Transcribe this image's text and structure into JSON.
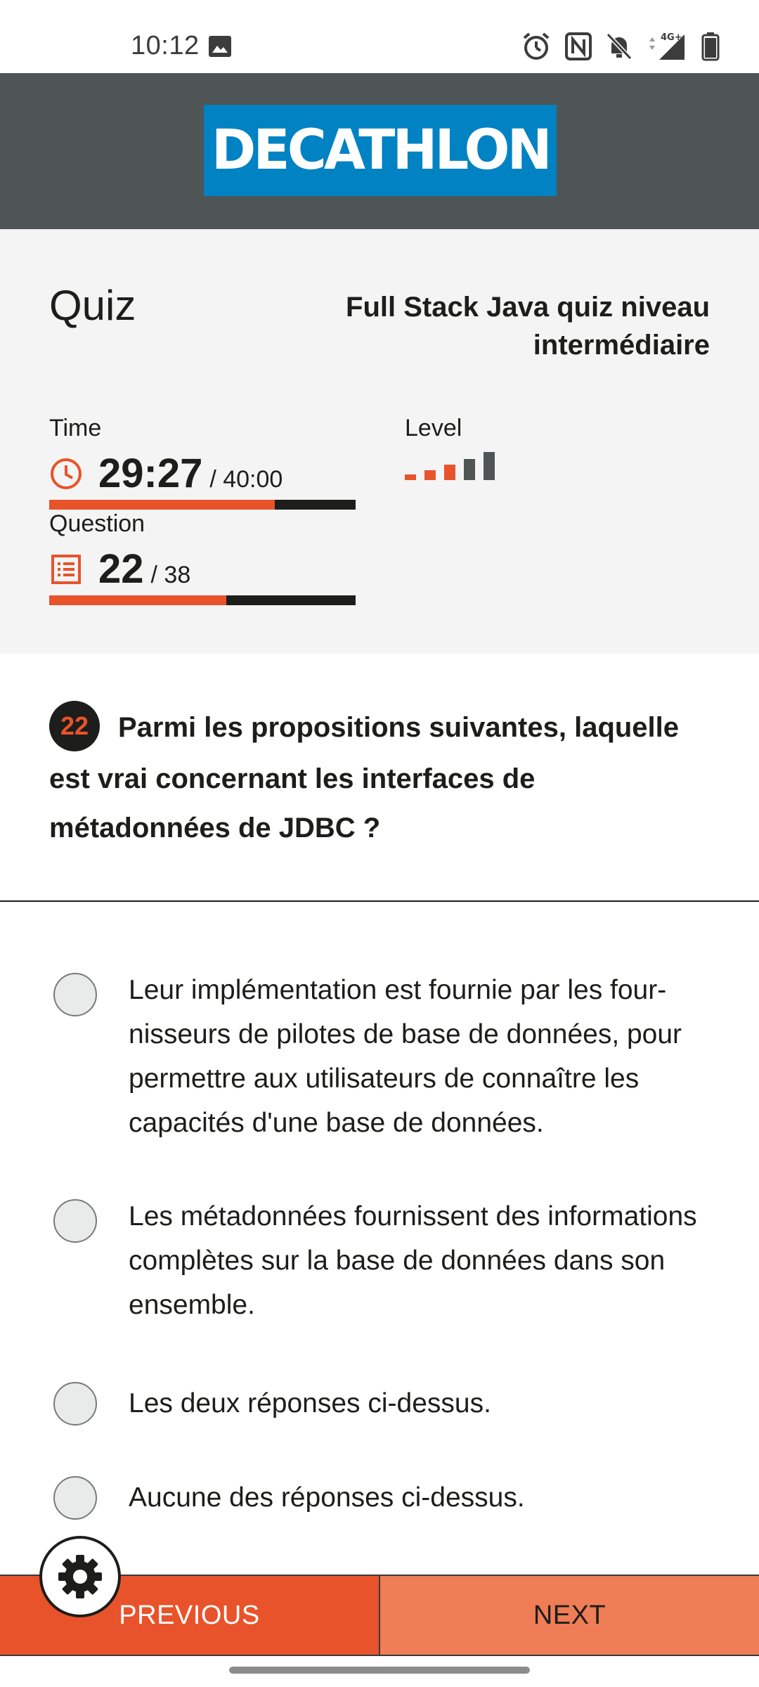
{
  "status_bar": {
    "time": "10:12",
    "icons": [
      "image-icon",
      "alarm-icon",
      "nfc-icon",
      "mute-icon",
      "signal-4g-icon",
      "battery-icon"
    ],
    "network": "4G+"
  },
  "brand": {
    "logo_text": "DECATHLON",
    "color": "#0082c3"
  },
  "quiz": {
    "title": "Quiz",
    "name": "Full Stack Java quiz niveau intermédiaire",
    "time_label": "Time",
    "time_value": "29:27",
    "time_total": "/ 40:00",
    "time_progress": 0.736,
    "question_label": "Question",
    "question_value": "22",
    "question_total": "/ 38",
    "question_progress": 0.579,
    "level_label": "Level",
    "level_value": 3,
    "level_max": 5
  },
  "question": {
    "number": "22",
    "text": "Parmi les propositions suivantes, laquelle est vrai concernant les interfaces de métadonnées de JDBC ?"
  },
  "answers": [
    "Leur implémentation est fournie par les four­nisseurs de pilotes de base de données, pour permettre aux utilisateurs de connaître les capacités d'une base de données.",
    "Les métadonnées fournissent des informa­tions complètes sur la base de données dans son ensemble.",
    "Les deux réponses ci-dessus.",
    "Aucune des réponses ci-dessus."
  ],
  "nav": {
    "previous_label": "PREVIOUS",
    "next_label": "NEXT"
  },
  "colors": {
    "accent": "#e8532b",
    "accent_light": "#ef7d55",
    "dark": "#1d1d1b",
    "header": "#4f5555"
  }
}
